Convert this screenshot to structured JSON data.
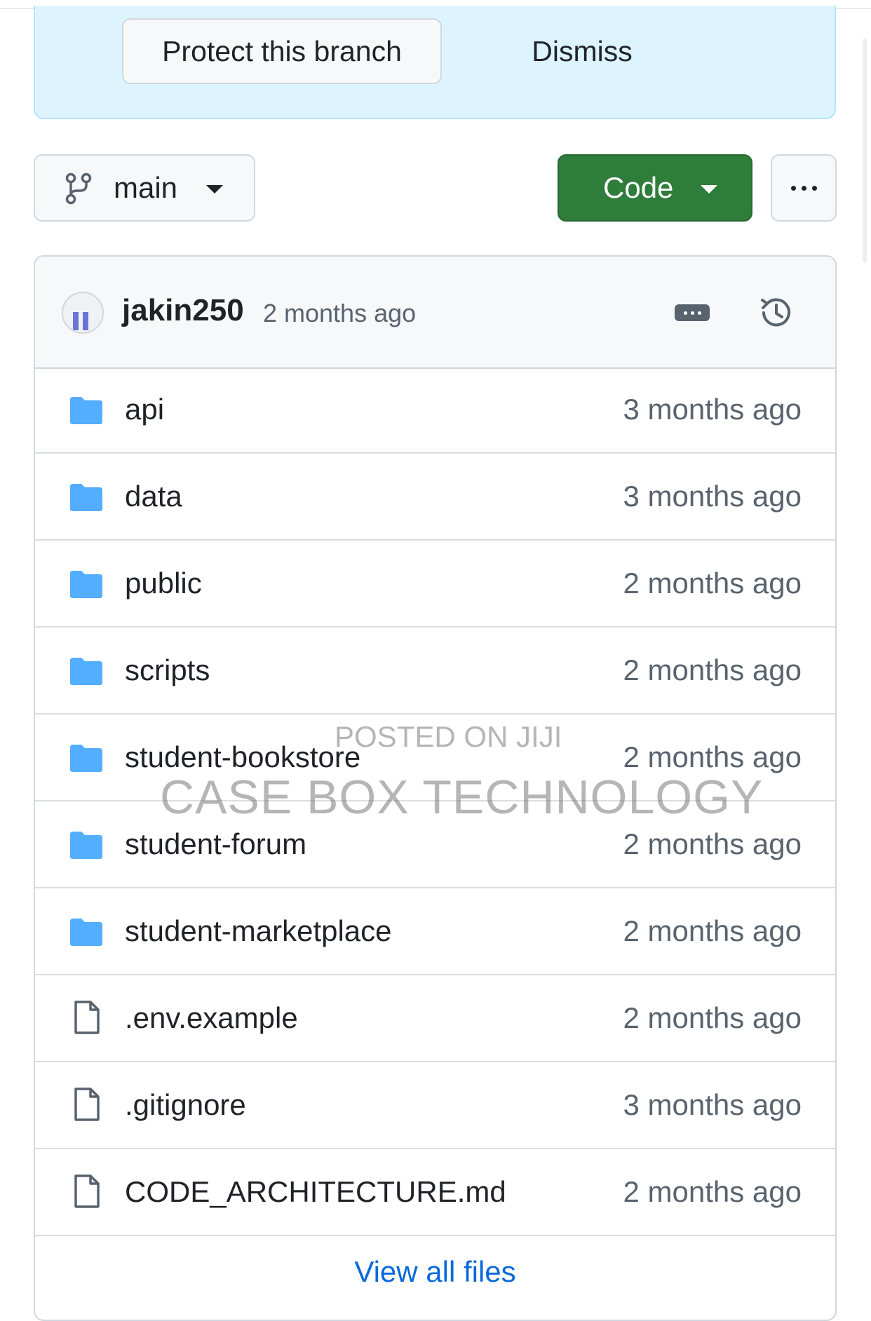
{
  "banner": {
    "protect_label": "Protect this branch",
    "dismiss_label": "Dismiss"
  },
  "branch": {
    "icon": "git-branch-icon",
    "name": "main"
  },
  "code_button": {
    "label": "Code"
  },
  "more_button": {
    "icon": "ellipsis-icon"
  },
  "latest_commit": {
    "author": "jakin250",
    "time": "2 months ago"
  },
  "files": [
    {
      "type": "folder",
      "name": "api",
      "age": "3 months ago"
    },
    {
      "type": "folder",
      "name": "data",
      "age": "3 months ago"
    },
    {
      "type": "folder",
      "name": "public",
      "age": "2 months ago"
    },
    {
      "type": "folder",
      "name": "scripts",
      "age": "2 months ago"
    },
    {
      "type": "folder",
      "name": "student-bookstore",
      "age": "2 months ago"
    },
    {
      "type": "folder",
      "name": "student-forum",
      "age": "2 months ago"
    },
    {
      "type": "folder",
      "name": "student-marketplace",
      "age": "2 months ago"
    },
    {
      "type": "file",
      "name": ".env.example",
      "age": "2 months ago"
    },
    {
      "type": "file",
      "name": ".gitignore",
      "age": "3 months ago"
    },
    {
      "type": "file",
      "name": "CODE_ARCHITECTURE.md",
      "age": "2 months ago"
    }
  ],
  "view_all_label": "View all files",
  "watermark": {
    "line1": "POSTED ON JIJI",
    "line2": "CASE BOX TECHNOLOGY"
  },
  "colors": {
    "banner_bg": "#ddf4ff",
    "code_button": "#2f7d3a",
    "folder": "#54aeff",
    "link": "#0969da"
  }
}
